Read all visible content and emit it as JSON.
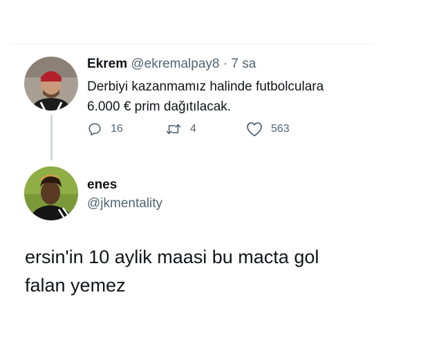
{
  "tweet": {
    "author_name": "Ekrem",
    "author_handle": "@ekremalpay8",
    "separator": "·",
    "time_ago": "7 sa",
    "text_line1": "Derbiyi kazanmamız halinde futbolculara",
    "text_line2": "6.000 € prim dağıtılacak.",
    "reply_count": "16",
    "retweet_count": "4",
    "like_count": "563",
    "icons": {
      "reply": "reply-icon",
      "retweet": "retweet-icon",
      "like": "heart-icon"
    }
  },
  "reply": {
    "author_name": "enes",
    "author_handle": "@jkmentality",
    "text_line1": "ersin'in 10 aylik maasi bu macta gol",
    "text_line2": "falan yemez"
  },
  "colors": {
    "text_primary": "#0f1419",
    "text_secondary": "#536471",
    "thread_line": "#cfd9de",
    "divider": "#eff3f4"
  }
}
